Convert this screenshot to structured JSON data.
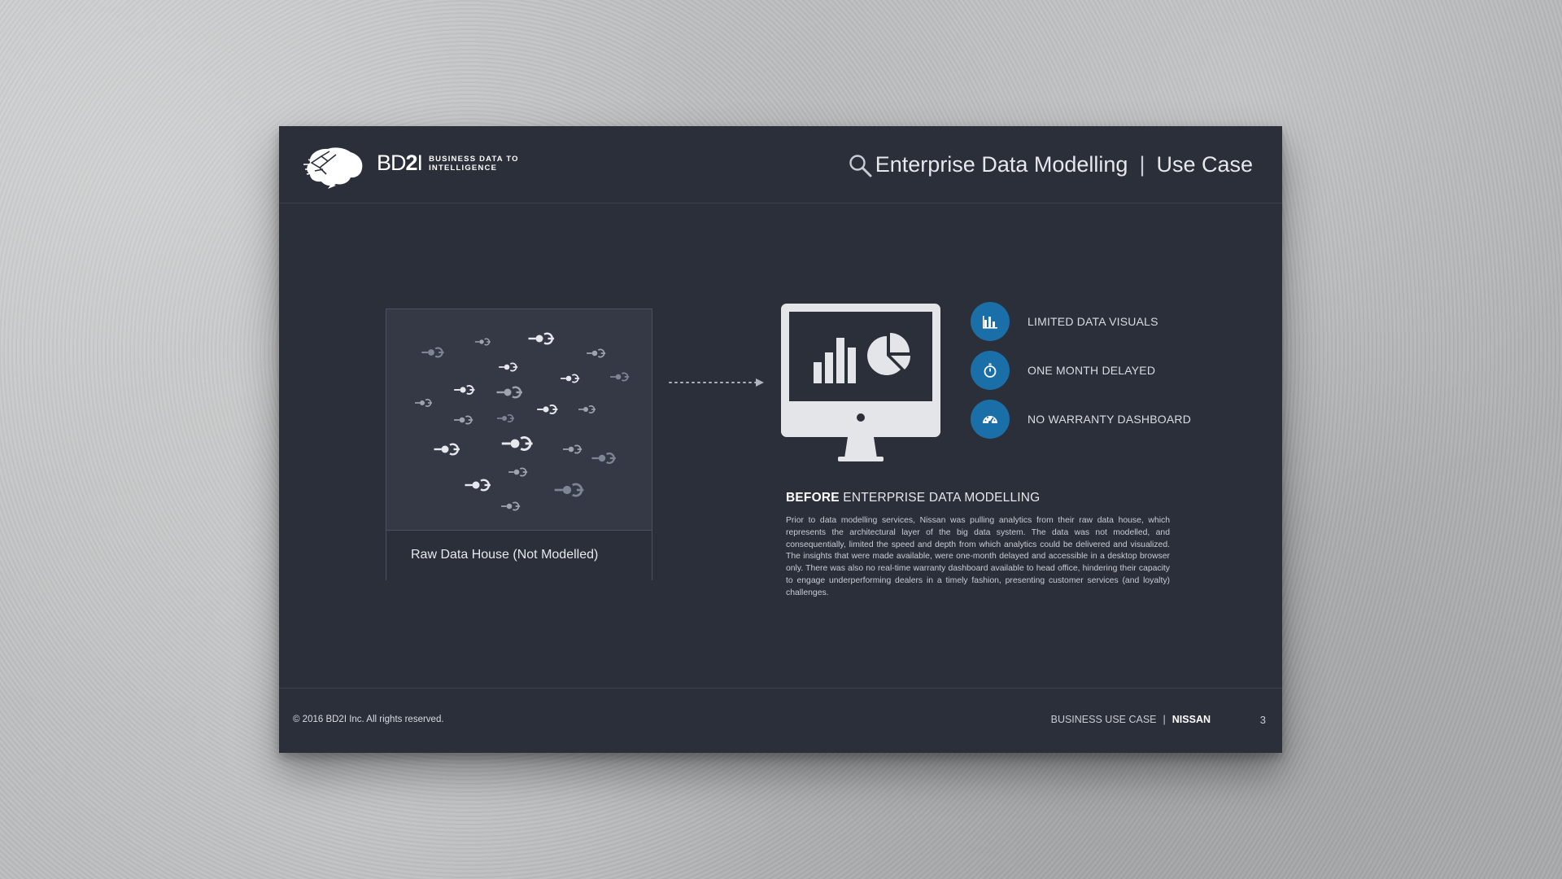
{
  "logo": {
    "name_light": "BD",
    "name_bold": "2",
    "name_suffix": "I",
    "tagline_line1": "BUSINESS DATA TO",
    "tagline_line2": "INTELLIGENCE"
  },
  "header": {
    "title": "Enterprise Data Modelling",
    "separator": "|",
    "subtitle": "Use Case",
    "icon": "search-icon"
  },
  "raw_data": {
    "caption": "Raw Data House (Not Modelled)",
    "icon": "data-node-icon"
  },
  "features": [
    {
      "icon": "bar-chart-icon",
      "label": "LIMITED DATA VISUALS"
    },
    {
      "icon": "stopwatch-icon",
      "label": "ONE MONTH DELAYED"
    },
    {
      "icon": "dashboard-gauge-icon",
      "label": "NO WARRANTY DASHBOARD"
    }
  ],
  "section": {
    "heading_bold": "BEFORE",
    "heading_rest": " ENTERPRISE DATA MODELLING",
    "body": "Prior to data modelling services, Nissan was pulling analytics from their raw data house, which represents the architectural layer of the big data system. The data was not modelled, and consequentially, limited the speed and depth from which analytics could be delivered and visualized. The insights that were made available, were one-month delayed and accessible in a desktop browser only. There was also no real-time warranty dashboard available to head office, hindering their capacity to engage underperforming dealers in a timely fashion, presenting customer services (and loyalty) challenges."
  },
  "footer": {
    "copyright": "© 2016 BD2I Inc. All rights reserved.",
    "case_label": "BUSINESS USE CASE",
    "separator": "|",
    "client": "NISSAN",
    "page_number": "3"
  },
  "colors": {
    "slide_bg": "#2b2f3a",
    "accent_blue": "#1b6fa8",
    "text": "#e6e8ec"
  }
}
